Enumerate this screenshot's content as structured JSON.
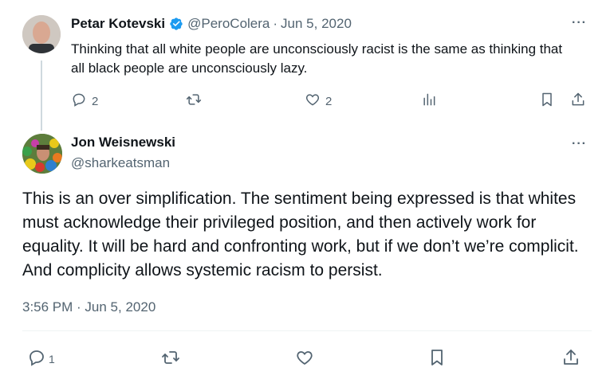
{
  "parent": {
    "author_name": "Petar Kotevski",
    "handle": "@PeroColera",
    "separator": "·",
    "date": "Jun 5, 2020",
    "text": "Thinking that all white people are unconsciously racist is the same as thinking that all black people are unconsciously lazy.",
    "more": "···",
    "replies": "2",
    "likes": "2"
  },
  "main": {
    "author_name": "Jon Weisnewski",
    "handle": "@sharkeatsman",
    "more": "···",
    "text": "This is an over simplification. The sentiment being expressed is that whites must acknowledge their privileged position, and then actively work for equality. It will be hard and confronting work, but if we don’t we’re complicit. And complicity allows systemic racism to  persist.",
    "timestamp": "3:56 PM · Jun 5, 2020",
    "replies": "1"
  },
  "colors": {
    "verified": "#1d9bf0",
    "secondary_text": "#536471",
    "thread_line": "#cfd9de"
  },
  "icons": [
    "verified-badge-icon",
    "reply-icon",
    "retweet-icon",
    "like-icon",
    "views-icon",
    "bookmark-icon",
    "share-icon"
  ]
}
